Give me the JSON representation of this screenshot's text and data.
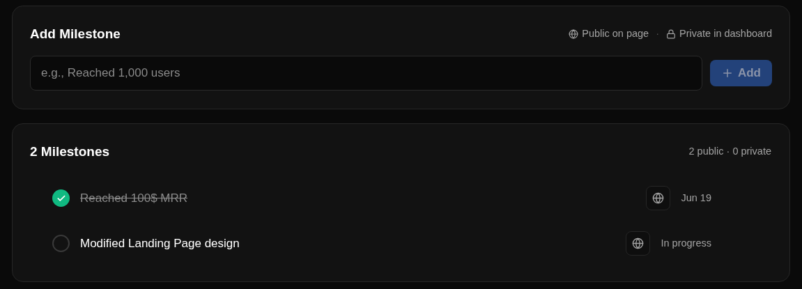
{
  "add_card": {
    "title": "Add Milestone",
    "hints": [
      {
        "kind": "public",
        "label": "Public on page"
      },
      {
        "kind": "private",
        "label": "Private in dashboard"
      }
    ],
    "separator": "·",
    "input": {
      "placeholder": "e.g., Reached 1,000 users"
    },
    "button": {
      "label": "Add",
      "disabled": true
    }
  },
  "list_card": {
    "title": "2 Milestones",
    "summary": "2 public · 0 private",
    "milestones": [
      {
        "title": "Reached 100$ MRR",
        "checked": true,
        "kind": "public",
        "status": "Jun 19"
      },
      {
        "title": "Modified Landing Page design",
        "checked": false,
        "kind": "public",
        "status": "In progress"
      }
    ]
  }
}
